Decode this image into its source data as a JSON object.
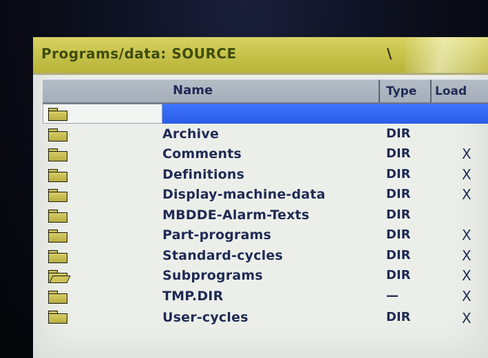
{
  "window": {
    "title": "Programs/data: SOURCE",
    "path": "\\"
  },
  "columns": {
    "name": "Name",
    "type": "Type",
    "load": "Load"
  },
  "rows": [
    {
      "name": "",
      "type": "",
      "load": "",
      "icon": "folder-up-icon",
      "selected": true
    },
    {
      "name": "Archive",
      "type": "DIR",
      "load": "",
      "icon": "folder-icon"
    },
    {
      "name": "Comments",
      "type": "DIR",
      "load": "X",
      "icon": "folder-icon"
    },
    {
      "name": "Definitions",
      "type": "DIR",
      "load": "X",
      "icon": "folder-icon"
    },
    {
      "name": "Display-machine-data",
      "type": "DIR",
      "load": "X",
      "icon": "folder-icon"
    },
    {
      "name": "MBDDE-Alarm-Texts",
      "type": "DIR",
      "load": "",
      "icon": "folder-icon"
    },
    {
      "name": "Part-programs",
      "type": "DIR",
      "load": "X",
      "icon": "folder-icon"
    },
    {
      "name": "Standard-cycles",
      "type": "DIR",
      "load": "X",
      "icon": "folder-icon"
    },
    {
      "name": "Subprograms",
      "type": "DIR",
      "load": "X",
      "icon": "folder-open-icon"
    },
    {
      "name": "TMP.DIR",
      "type": "—",
      "load": "X",
      "icon": "folder-icon"
    },
    {
      "name": "User-cycles",
      "type": "DIR",
      "load": "X",
      "icon": "folder-icon"
    }
  ],
  "colors": {
    "title_bar": "#c9c44c",
    "selection": "#2a5ce6",
    "text": "#1f2a55",
    "header": "#a5aeb9"
  }
}
